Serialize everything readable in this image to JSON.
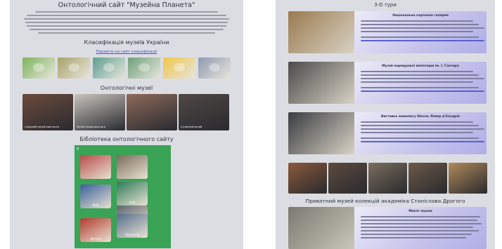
{
  "left": {
    "title": "Онтологічний сайт \"Музейна Планета\"",
    "classification": {
      "heading": "Класифікація музеїв України",
      "link": "Перейти на сайт класифікації",
      "tiles": [
        {
          "icon": "map-icon",
          "color": "#7db35a"
        },
        {
          "icon": "map-icon",
          "color": "#a8a368"
        },
        {
          "icon": "map-icon",
          "color": "#5d9e8e"
        },
        {
          "icon": "map-icon",
          "color": "#6ea07a"
        },
        {
          "icon": "flag-icon",
          "color": "#f0c64a"
        },
        {
          "icon": "seal-icon",
          "color": "#8f99ae"
        }
      ]
    },
    "museums": {
      "heading": "Онтологічні музеї",
      "items": [
        {
          "caption": "Середній музей мистецтв",
          "color": "#6b4b3c"
        },
        {
          "caption": "Музей Національного",
          "color": "#c9c3bc"
        },
        {
          "caption": "",
          "color": "#8d6a5a"
        },
        {
          "caption": "Сучасний музей",
          "color": "#4f4845"
        }
      ]
    },
    "library": {
      "heading": "Бібліотека онтологічного сайту",
      "tiles": [
        {
          "label": "",
          "color": "#b94a4a"
        },
        {
          "label": "",
          "color": "#7b6a5a"
        },
        {
          "label": "Київ",
          "color": "#2f7a5a"
        },
        {
          "label": "Київ",
          "color": "#3a5f9b"
        },
        {
          "label": "Одеса",
          "color": "#5e6570"
        },
        {
          "label": "Одеський",
          "color": "#566d8c"
        },
        {
          "label": "Дитяча",
          "color": "#b3392f"
        }
      ]
    }
  },
  "right": {
    "title": "3-D тури",
    "cards": [
      {
        "title": "Національна картинна галерея",
        "color": "#9a7a4f"
      },
      {
        "title": "Музей мармурової мініатюри ім. І. Гончара",
        "color": "#4b4b4b"
      },
      {
        "title": "Виставка живопису Ніколь Левер д'Ельдрін",
        "color": "#3a3c42"
      }
    ],
    "strip_colors": [
      "#8b5a3c",
      "#5d4b40",
      "#7a6e5e",
      "#6d5a48",
      "#b08a5a"
    ],
    "private_heading": "Приватний музей колекцій академіка Станіслава Дрогого",
    "private_card_title": "Макет музею",
    "private_color": "#7a7a70"
  }
}
